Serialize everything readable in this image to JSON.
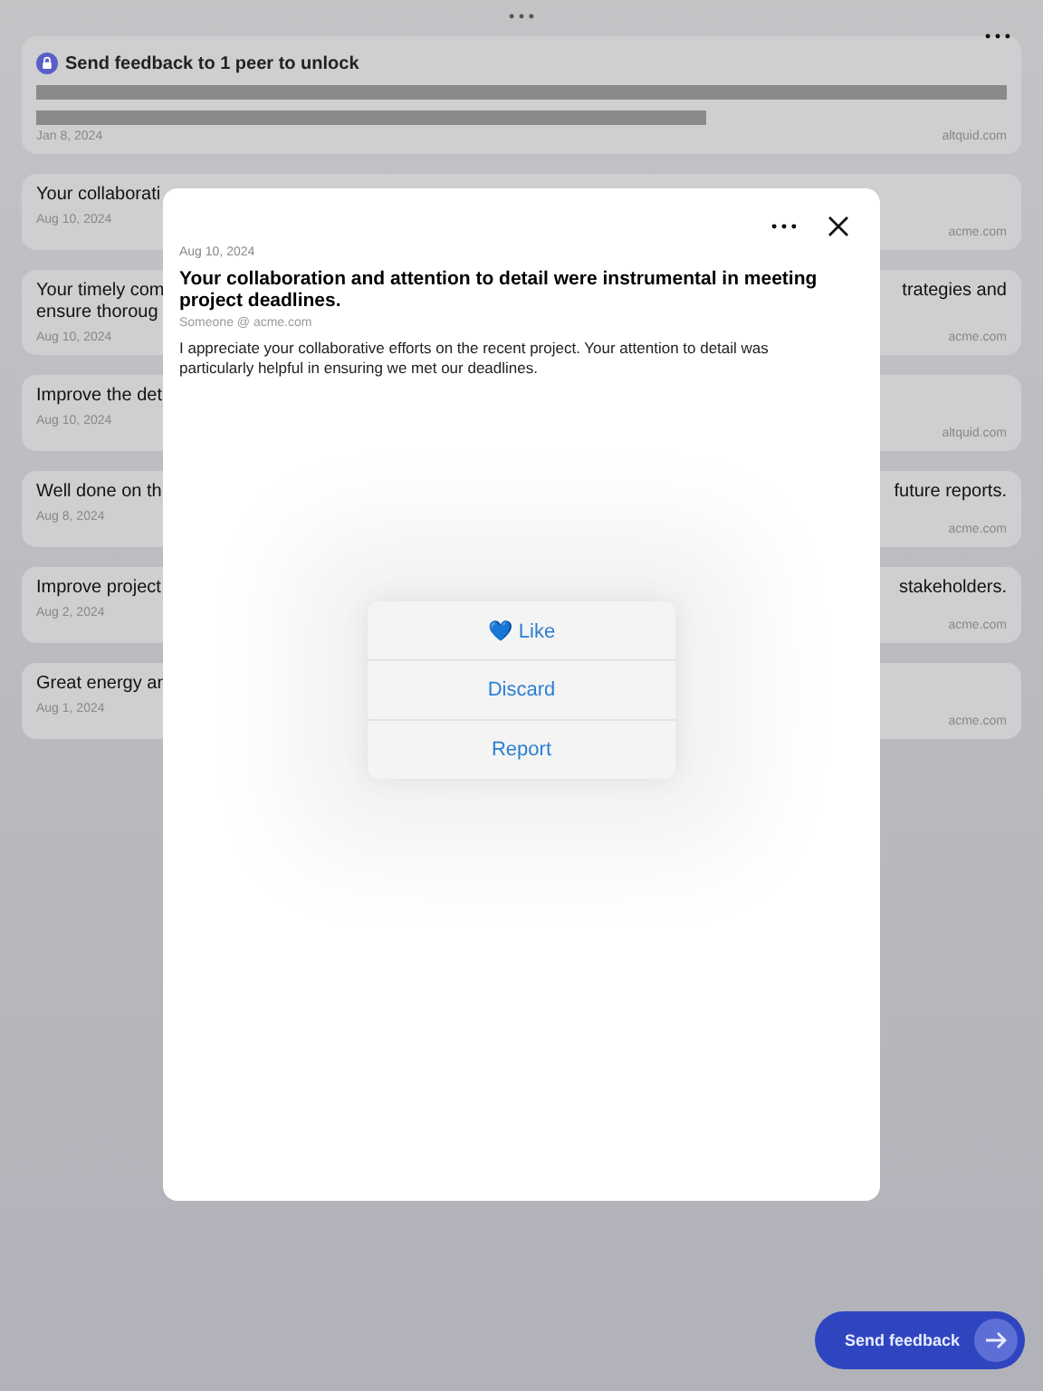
{
  "locked_card": {
    "message": "Send feedback to 1 peer to unlock",
    "date": "Jan 8, 2024",
    "domain": "altquid.com"
  },
  "cards": [
    {
      "title_left": [
        "Your collaborati"
      ],
      "date": "Aug 10, 2024",
      "domain": "acme.com"
    },
    {
      "title_left": [
        "Your timely com",
        "ensure thoroug"
      ],
      "title_right": "trategies and",
      "date": "Aug 10, 2024",
      "domain": "acme.com"
    },
    {
      "title_left": [
        "Improve the det"
      ],
      "date": "Aug 10, 2024",
      "domain": "altquid.com"
    },
    {
      "title_left": [
        "Well done on th"
      ],
      "title_right": "future reports.",
      "date": "Aug 8, 2024",
      "domain": "acme.com"
    },
    {
      "title_left": [
        "Improve project"
      ],
      "title_right": "stakeholders.",
      "date": "Aug 2, 2024",
      "domain": "acme.com"
    },
    {
      "title_left": [
        "Great energy an"
      ],
      "date": "Aug 1, 2024",
      "domain": "acme.com"
    }
  ],
  "modal": {
    "date": "Aug 10, 2024",
    "title": "Your collaboration and attention to detail were instrumental in meeting project deadlines.",
    "author": "Someone @ acme.com",
    "body": "I appreciate your collaborative efforts on the recent project. Your attention to detail was particularly helpful in ensuring we met our deadlines.",
    "actions": [
      {
        "label": "💙 Like"
      },
      {
        "label": "Discard"
      },
      {
        "label": "Report"
      }
    ]
  },
  "send_button": {
    "label": "Send feedback"
  }
}
